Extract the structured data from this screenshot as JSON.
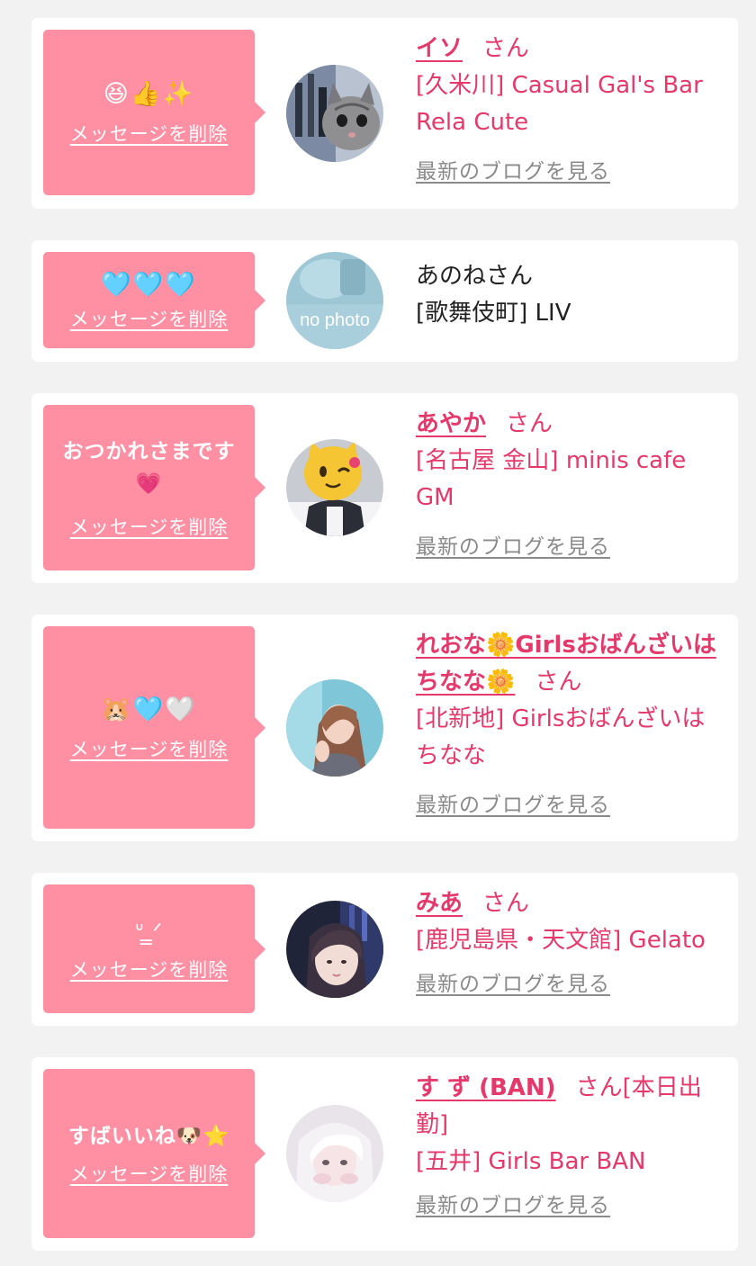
{
  "messages": [
    {
      "message": "😆👍✨",
      "delete_label": "メッセージを削除",
      "name": "イソ",
      "suffix": "さん",
      "shop": "[久米川] Casual Gal's Bar Rela Cute",
      "blog_label": "最新のブログを見る",
      "avatar": "avatar-cat-photo"
    },
    {
      "message": "🩵🩵🩵",
      "delete_label": "メッセージを削除",
      "name": "あのね",
      "suffix": "さん",
      "shop": "[歌舞伎町] LIV",
      "avatar_text": "no photo",
      "avatar": "avatar-no-photo"
    },
    {
      "message": "おつかれさまです💗",
      "delete_label": "メッセージを削除",
      "name": "あやか",
      "suffix": "さん",
      "shop": "[名古屋 金山] minis cafe GM",
      "blog_label": "最新のブログを見る",
      "avatar": "avatar-cat-mask"
    },
    {
      "message": "🐹🩵🤍",
      "delete_label": "メッセージを削除",
      "name": "れおな🌼Girlsおばんざいはちなな🌼",
      "suffix": "さん",
      "shop": "[北新地] Girlsおばんざいはちなな",
      "blog_label": "最新のブログを見る",
      "avatar": "avatar-woman-photo"
    },
    {
      "message": "ᐡ ̳ᐟ",
      "delete_label": "メッセージを削除",
      "name": "みあ",
      "suffix": "さん",
      "shop": "[鹿児島県・天文館] Gelato",
      "blog_label": "最新のブログを見る",
      "avatar": "avatar-woman-dark"
    },
    {
      "message": "すばいいね🐶⭐",
      "delete_label": "メッセージを削除",
      "name": "す ず (BAN)",
      "suffix": "さん[本日出勤]",
      "shop": "[五井] Girls Bar BAN",
      "blog_label": "最新のブログを見る",
      "avatar": "avatar-woman-light"
    }
  ],
  "colors": {
    "page_background": "#f2f2f2",
    "card_background": "#ffffff",
    "bubble_pink": "#ff8fa3",
    "name_pink": "#e5386b",
    "link_gray": "#8a8a8a"
  }
}
